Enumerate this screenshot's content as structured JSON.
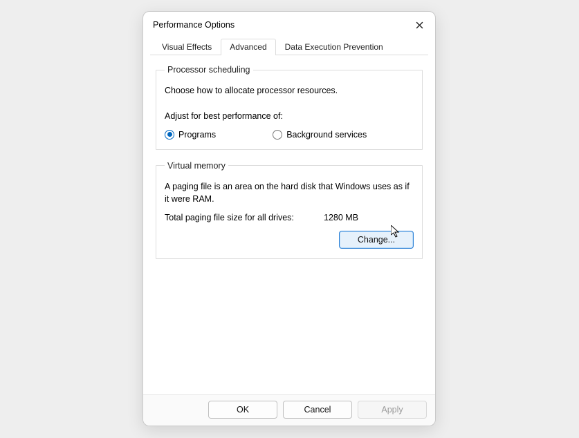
{
  "dialog": {
    "title": "Performance Options"
  },
  "tabs": {
    "visual_effects": "Visual Effects",
    "advanced": "Advanced",
    "dep": "Data Execution Prevention"
  },
  "processor": {
    "legend": "Processor scheduling",
    "intro": "Choose how to allocate processor resources.",
    "adjust_label": "Adjust for best performance of:",
    "option_programs": "Programs",
    "option_background": "Background services"
  },
  "vm": {
    "legend": "Virtual memory",
    "intro": "A paging file is an area on the hard disk that Windows uses as if it were RAM.",
    "total_label": "Total paging file size for all drives:",
    "total_value": "1280 MB",
    "change_label": "Change..."
  },
  "footer": {
    "ok": "OK",
    "cancel": "Cancel",
    "apply": "Apply"
  }
}
